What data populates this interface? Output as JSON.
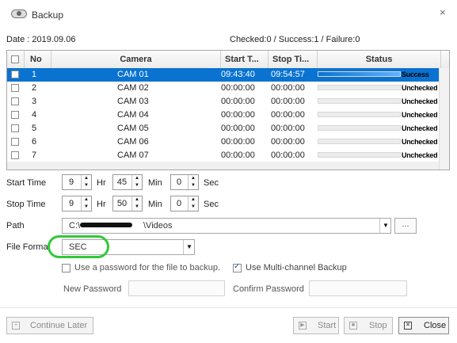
{
  "window": {
    "title": "Backup",
    "close_glyph": "×"
  },
  "header": {
    "date": "Date : 2019.09.06",
    "summary": "Checked:0 / Success:1 / Failure:0"
  },
  "table": {
    "columns": {
      "no": "No",
      "camera": "Camera",
      "start": "Start T...",
      "stop": "Stop Ti...",
      "status": "Status"
    },
    "rows": [
      {
        "no": "1",
        "camera": "CAM 01",
        "start": "09:43:40",
        "stop": "09:54:57",
        "status": "Success",
        "progress": 1.0,
        "selected": true
      },
      {
        "no": "2",
        "camera": "CAM 02",
        "start": "00:00:00",
        "stop": "00:00:00",
        "status": "Unchecked",
        "progress": 0
      },
      {
        "no": "3",
        "camera": "CAM 03",
        "start": "00:00:00",
        "stop": "00:00:00",
        "status": "Unchecked",
        "progress": 0
      },
      {
        "no": "4",
        "camera": "CAM 04",
        "start": "00:00:00",
        "stop": "00:00:00",
        "status": "Unchecked",
        "progress": 0
      },
      {
        "no": "5",
        "camera": "CAM 05",
        "start": "00:00:00",
        "stop": "00:00:00",
        "status": "Unchecked",
        "progress": 0
      },
      {
        "no": "6",
        "camera": "CAM 06",
        "start": "00:00:00",
        "stop": "00:00:00",
        "status": "Unchecked",
        "progress": 0
      },
      {
        "no": "7",
        "camera": "CAM 07",
        "start": "00:00:00",
        "stop": "00:00:00",
        "status": "Unchecked",
        "progress": 0
      }
    ]
  },
  "start_time": {
    "label": "Start Time",
    "hour": "9",
    "hr_unit": "Hr",
    "minute": "45",
    "min_unit": "Min",
    "second": "0",
    "sec_unit": "Sec"
  },
  "stop_time": {
    "label": "Stop Time",
    "hour": "9",
    "hr_unit": "Hr",
    "minute": "50",
    "min_unit": "Min",
    "second": "0",
    "sec_unit": "Sec"
  },
  "path": {
    "label": "Path",
    "value_start": "C:\\",
    "value_end": "\\Videos",
    "browse_label": "..."
  },
  "file_format": {
    "label": "File Format",
    "value": "SEC"
  },
  "options": {
    "use_password": {
      "label": "Use a password for the file to backup.",
      "checked": false
    },
    "multi_channel": {
      "label": "Use Multi-channel Backup",
      "checked": true
    }
  },
  "passwords": {
    "new_label": "New Password",
    "confirm_label": "Confirm Password"
  },
  "footer": {
    "continue_label": "Continue Later",
    "start_label": "Start",
    "stop_label": "Stop",
    "close_label": "Close"
  },
  "colors": {
    "selection": "#0a73d1",
    "highlight_circle": "#32c83a"
  }
}
